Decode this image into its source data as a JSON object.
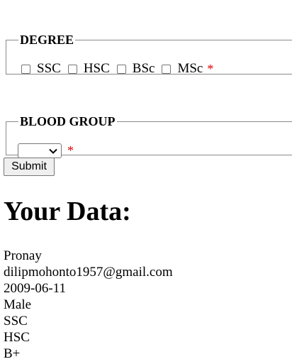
{
  "degree": {
    "legend": "DEGREE",
    "options": [
      "SSC",
      "HSC",
      "BSc",
      "MSc"
    ],
    "required_marker": "*"
  },
  "blood_group": {
    "legend": "BLOOD GROUP",
    "selected": "",
    "required_marker": "*"
  },
  "submit_label": "Submit",
  "result": {
    "heading": "Your Data:",
    "name": "Pronay",
    "email": "dilipmohonto1957@gmail.com",
    "date": "2009-06-11",
    "gender": "Male",
    "degree_1": "SSC",
    "degree_2": "HSC",
    "blood": "B+"
  },
  "colors": {
    "required": "#e00000",
    "border": "#8a8a8a"
  }
}
